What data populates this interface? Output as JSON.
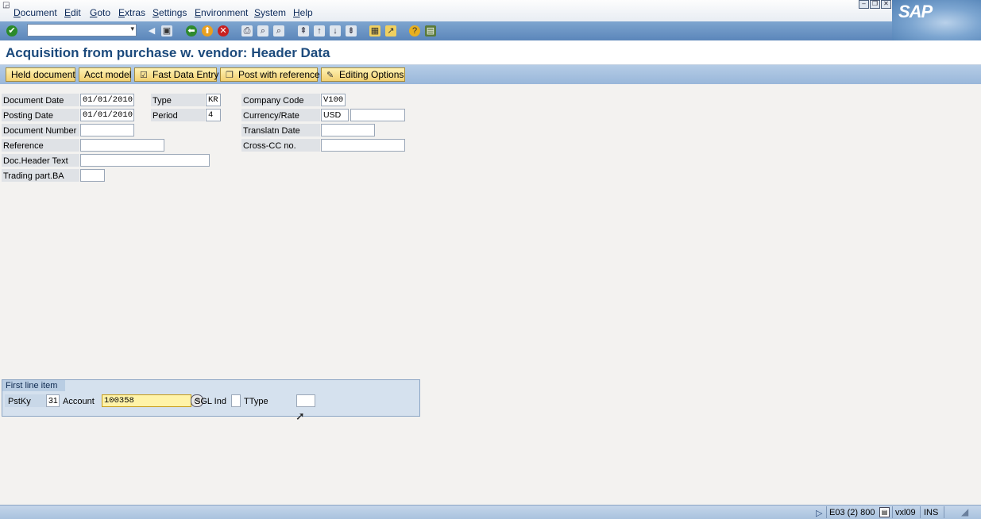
{
  "menu": {
    "items": [
      "Document",
      "Edit",
      "Goto",
      "Extras",
      "Settings",
      "Environment",
      "System",
      "Help"
    ]
  },
  "brand": {
    "logo": "SAP"
  },
  "toolbar": {
    "command_value": "",
    "icons": [
      "enter-icon",
      "back-icon",
      "save-icon",
      "back-arrow-icon",
      "exit-icon",
      "cancel-icon",
      "print-icon",
      "find-icon",
      "find-next-icon",
      "first-page-icon",
      "prev-page-icon",
      "next-page-icon",
      "last-page-icon",
      "create-session-icon",
      "shortcut-icon",
      "help-icon",
      "layout-icon"
    ]
  },
  "title": "Acquisition from purchase w. vendor: Header Data",
  "app_toolbar": {
    "held_document": "Held document",
    "acct_model": "Acct model",
    "fast_data_entry": "Fast Data Entry",
    "post_with_reference": "Post with reference",
    "editing_options": "Editing Options"
  },
  "header": {
    "document_date": {
      "label": "Document Date",
      "value": "01/01/2010"
    },
    "posting_date": {
      "label": "Posting Date",
      "value": "01/01/2010"
    },
    "document_number": {
      "label": "Document Number",
      "value": ""
    },
    "reference": {
      "label": "Reference",
      "value": ""
    },
    "doc_header_text": {
      "label": "Doc.Header Text",
      "value": ""
    },
    "trading_part_ba": {
      "label": "Trading part.BA",
      "value": ""
    },
    "type": {
      "label": "Type",
      "value": "KR"
    },
    "period": {
      "label": "Period",
      "value": "4"
    },
    "company_code": {
      "label": "Company Code",
      "value": "V100"
    },
    "currency_rate": {
      "label": "Currency/Rate",
      "currency": "USD",
      "rate": ""
    },
    "translatn_date": {
      "label": "Translatn Date",
      "value": ""
    },
    "cross_cc_no": {
      "label": "Cross-CC no.",
      "value": ""
    }
  },
  "first_line_item": {
    "title": "First line item",
    "pstky": {
      "label": "PstKy",
      "value": "31"
    },
    "account": {
      "label": "Account",
      "value": "100358"
    },
    "sgl_ind": {
      "label": "SGL Ind",
      "value": ""
    },
    "ttype": {
      "label": "TType",
      "value": ""
    }
  },
  "status": {
    "system": "E03 (2) 800",
    "server": "vxl09",
    "mode": "INS"
  },
  "colors": {
    "title": "#1c4a7c",
    "toolbar": "#5b86ba",
    "app_button": "#f2d173",
    "focused_field": "#fff3a8"
  }
}
